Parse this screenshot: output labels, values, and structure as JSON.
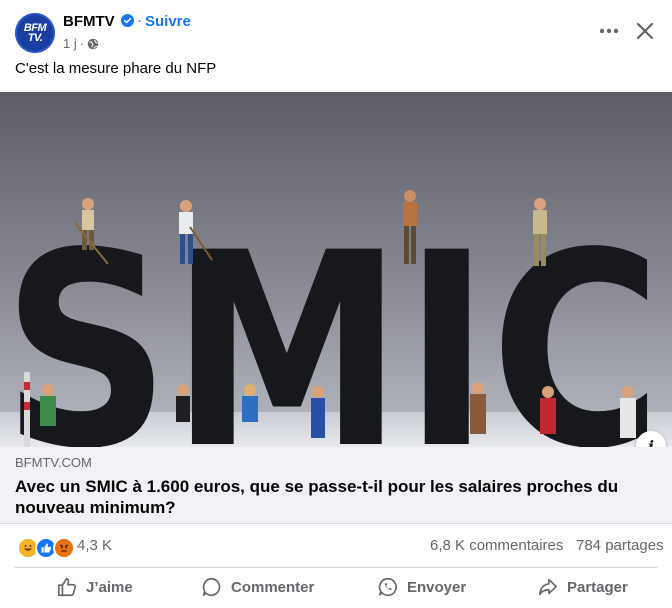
{
  "post": {
    "page_name": "BFMTV",
    "avatar_text_top": "BFM",
    "avatar_text_bottom": "TV.",
    "separator": "·",
    "follow_label": "Suivre",
    "time": "1 j",
    "meta_separator": "·",
    "caption": "C'est la mesure phare du NFP"
  },
  "photo": {
    "headline_letters": "SMIC"
  },
  "link": {
    "domain": "BFMTV.COM",
    "title": "Avec un SMIC à 1.600 euros, que se passe-t-il pour les salaires proches du nouveau minimum?"
  },
  "stats": {
    "reaction_icons": [
      "haha-icon",
      "like-icon",
      "angry-icon"
    ],
    "reaction_count": "4,3 K",
    "comments": "6,8 K commentaires",
    "shares": "784 partages"
  },
  "actions": {
    "like": "J’aime",
    "comment": "Commenter",
    "send": "Envoyer",
    "share": "Partager"
  },
  "colors": {
    "brand_blue": "#1877f2",
    "avatar_blue": "#1a3fa0",
    "muted_text": "#65676b",
    "link_bg": "#f0f2f5"
  }
}
